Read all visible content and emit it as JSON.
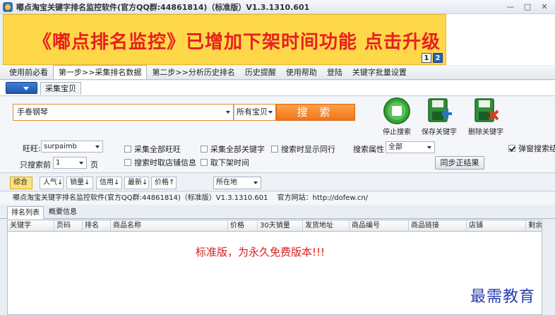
{
  "window": {
    "title": "嘟点淘宝关键字排名监控软件(官方QQ群:44861814)（标准版）V1.3.1310.601",
    "controls": [
      "—",
      "□",
      "✕"
    ]
  },
  "banner": {
    "text": "《嘟点排名监控》已增加下架时间功能   点击升级",
    "pages": [
      "1",
      "2"
    ],
    "active_page": "2"
  },
  "menu": {
    "tabs": [
      "使用前必看",
      "第一步>>采集排名数据",
      "第二步>>分析历史排名",
      "历史提醒",
      "使用帮助",
      "登陆",
      "关键字批量设置"
    ],
    "active_index": 1
  },
  "subtabs": {
    "tab_label": "采集宝贝"
  },
  "search": {
    "keyword_value": "手卷钢琴",
    "scope_value": "所有宝贝",
    "search_label": "搜 索"
  },
  "tools": {
    "stop_label": "停止搜索",
    "save_label": "保存关键字",
    "delete_label": "删除关键字"
  },
  "options": {
    "wangwang_label": "旺旺:",
    "wangwang_value": "surpaimb",
    "only_search_label": "只搜索前",
    "only_search_value": "1",
    "page_unit": "页",
    "collect_all_wangwang": "采集全部旺旺",
    "collect_all_keywords": "采集全部关键字",
    "show_peers": "搜索时显示同行",
    "fetch_shop_info": "搜索时取店铺信息",
    "fetch_delist_time": "取下架时间",
    "search_attr_label": "搜索属性",
    "search_attr_value": "全部",
    "popup_result": "弹窗搜索结",
    "popup_checked": true,
    "sync_label": "同步正结果"
  },
  "sort": {
    "buttons": [
      "综合",
      "人气↓",
      "销量↓",
      "信用↓",
      "最新↓",
      "价格↑"
    ],
    "active_index": 0,
    "location_value": "所在地"
  },
  "info": {
    "product": "嘟点淘宝关键字排名监控软件(官方QQ群:44861814)（标准版）V1.3.1310.601",
    "site": "官方网站：http://dofew.cn/"
  },
  "result_tabs": [
    "排名列表",
    "概要信息"
  ],
  "table": {
    "columns": [
      "关键字",
      "页码",
      "排名",
      "商品名称",
      "价格",
      "30天销量",
      "发货地址",
      "商品编号",
      "商品链接",
      "店铺",
      "剩余"
    ],
    "notice": "标准版，为永久免费版本!!!"
  },
  "watermark": "最需教育",
  "colors": {
    "banner_bg": "#ffd84a",
    "banner_text": "#e8201e",
    "search_orange": "#f0741a",
    "notice_red": "#d52020"
  }
}
